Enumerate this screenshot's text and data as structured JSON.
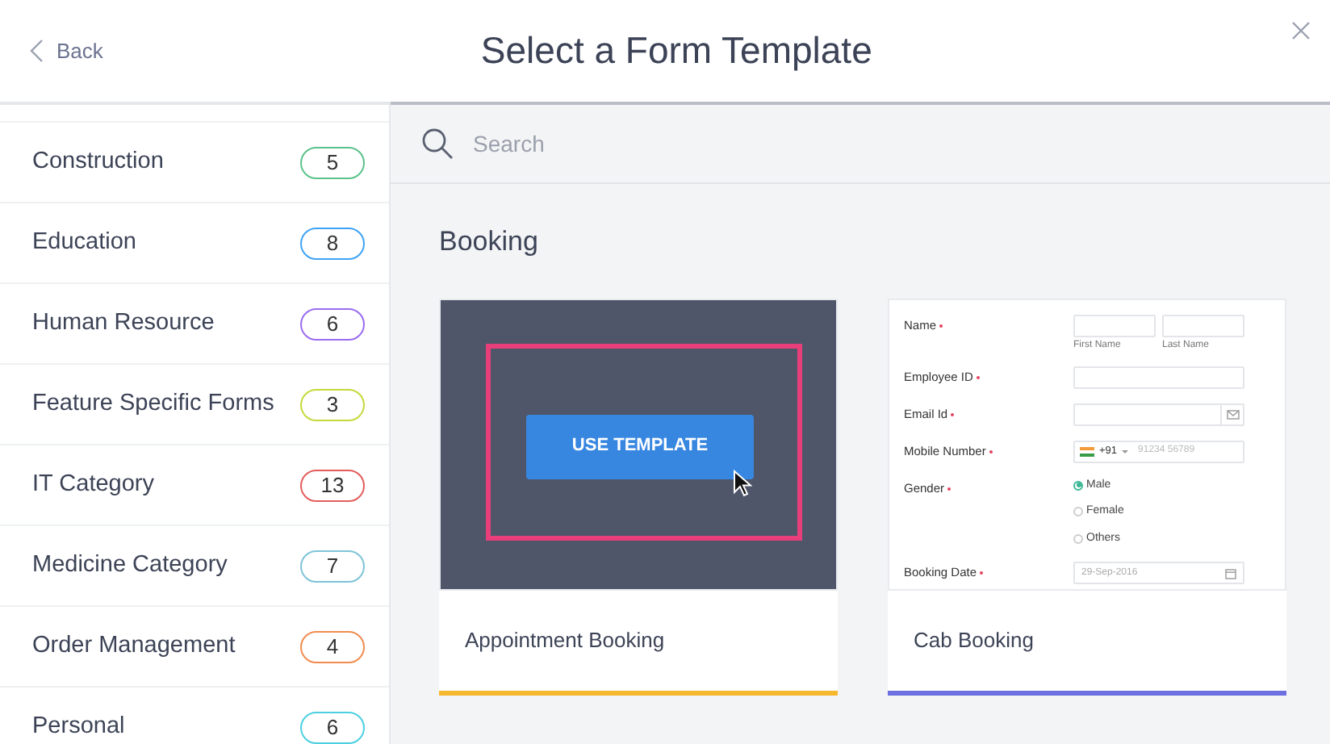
{
  "header": {
    "back": "Back",
    "title": "Select a Form Template"
  },
  "categories": [
    {
      "label": "Construction",
      "count": "5",
      "color": "#5cc28b"
    },
    {
      "label": "Education",
      "count": "8",
      "color": "#3fa3f5"
    },
    {
      "label": "Human Resource",
      "count": "6",
      "color": "#9b6cf0"
    },
    {
      "label": "Feature Specific Forms",
      "count": "3",
      "color": "#c5d93a"
    },
    {
      "label": "IT Category",
      "count": "13",
      "color": "#e35d5d"
    },
    {
      "label": "Medicine Category",
      "count": "7",
      "color": "#7ec3d8"
    },
    {
      "label": "Order Management",
      "count": "4",
      "color": "#f08c4f"
    },
    {
      "label": "Personal",
      "count": "6",
      "color": "#4ccfe0"
    }
  ],
  "search": {
    "placeholder": "Search"
  },
  "section": "Booking",
  "templates": [
    {
      "name": "Appointment Booking",
      "color": "#f5b82e",
      "hovered": true,
      "action": "USE TEMPLATE"
    },
    {
      "name": "Cab Booking",
      "color": "#6b6fe0",
      "hovered": false,
      "fields": [
        {
          "kind": "name",
          "label": "Name",
          "required": true,
          "sub": [
            "First Name",
            "Last Name"
          ]
        },
        {
          "kind": "text",
          "label": "Employee ID",
          "required": true
        },
        {
          "kind": "email",
          "label": "Email Id",
          "required": true
        },
        {
          "kind": "phone",
          "label": "Mobile Number",
          "required": true,
          "code": "+91",
          "placeholder": "91234 56789"
        },
        {
          "kind": "radio",
          "label": "Gender",
          "required": true,
          "options": [
            {
              "label": "Male",
              "selected": true
            },
            {
              "label": "Female",
              "selected": false
            },
            {
              "label": "Others",
              "selected": false
            }
          ]
        },
        {
          "kind": "date",
          "label": "Booking Date",
          "required": true,
          "placeholder": "29-Sep-2016"
        }
      ]
    }
  ]
}
